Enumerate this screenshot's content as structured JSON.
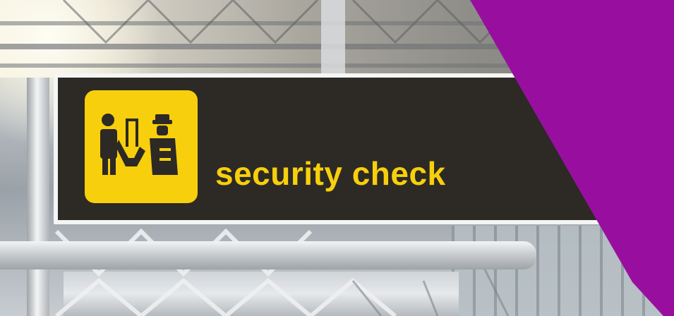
{
  "sign": {
    "label": "security check"
  },
  "colors": {
    "sign_background": "#2d2925",
    "sign_yellow": "#f7cf0c",
    "accent_purple": "#980fa0"
  },
  "icons": [
    "security-checkpoint-icon"
  ]
}
